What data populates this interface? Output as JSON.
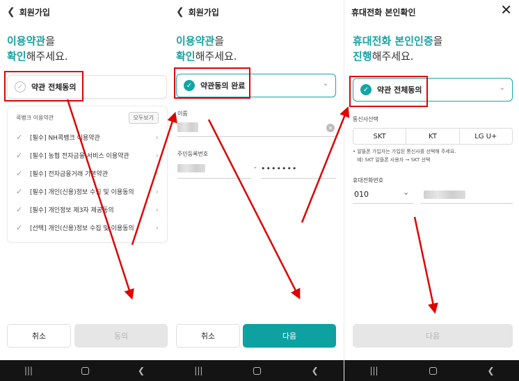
{
  "colors": {
    "accent": "#1aa0a0",
    "primary_button": "#0ea1a1",
    "annotation": "#e00000"
  },
  "screen1": {
    "header_title": "회원가입",
    "heading_accent_1": "이용약관",
    "heading_rest_1": "을",
    "heading_accent_2": "확인",
    "heading_rest_2": "해주세요.",
    "agree_all_label": "약관 전체동의",
    "terms_title": "콕뱅크 이용약관",
    "view_all": "모두보기",
    "terms": [
      "[필수] NH콕뱅크 이용약관",
      "[필수] 농협 전자금융 서비스 이용약관",
      "[필수] 전자금융거래 기본약관",
      "[필수] 개인(신용)정보 수집 및 이용동의",
      "[필수] 개인정보 제3자 제공동의",
      "[선택] 개인(신용)정보 수집 및 이용동의"
    ],
    "cancel_label": "취소",
    "agree_label": "동의"
  },
  "screen2": {
    "header_title": "회원가입",
    "heading_accent_1": "이용약관",
    "heading_rest_1": "을",
    "heading_accent_2": "확인",
    "heading_rest_2": "해주세요.",
    "agree_done_label": "약관동의 완료",
    "name_label": "이름",
    "rrn_label": "주민등록번호",
    "rrn_dash": "-",
    "rrn_masked": "•••••••",
    "cancel_label": "취소",
    "next_label": "다음"
  },
  "screen3": {
    "header_title": "휴대전화 본인확인",
    "heading_accent_1": "휴대전화 본인인증",
    "heading_rest_1": "을",
    "heading_accent_2": "진행",
    "heading_rest_2": "해주세요.",
    "agree_all_label": "약관 전체동의",
    "carrier_label": "통신사선택",
    "carriers": [
      "SKT",
      "KT",
      "LG U+"
    ],
    "note_1": "• 알뜰폰 가입자는 가입된 통신사를 선택해 주세요.",
    "note_2": "예) SKT 알뜰폰 사용자 → SKT 선택",
    "phone_label": "휴대전화번호",
    "phone_prefix": "010",
    "next_label": "다음"
  }
}
